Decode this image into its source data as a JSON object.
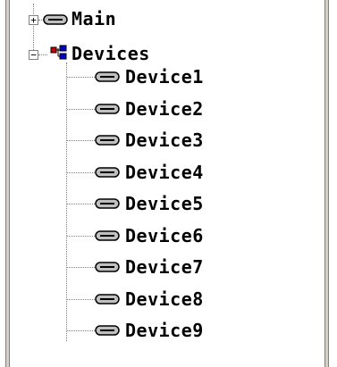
{
  "tree": {
    "main": {
      "label": "Main",
      "expander": "+",
      "icon": "device-icon"
    },
    "devices": {
      "label": "Devices",
      "expander": "−",
      "icon": "network-group-icon",
      "children": [
        {
          "label": "Device1",
          "icon": "device-icon"
        },
        {
          "label": "Device2",
          "icon": "device-icon"
        },
        {
          "label": "Device3",
          "icon": "device-icon"
        },
        {
          "label": "Device4",
          "icon": "device-icon"
        },
        {
          "label": "Device5",
          "icon": "device-icon"
        },
        {
          "label": "Device6",
          "icon": "device-icon"
        },
        {
          "label": "Device7",
          "icon": "device-icon"
        },
        {
          "label": "Device8",
          "icon": "device-icon"
        },
        {
          "label": "Device9",
          "icon": "device-icon"
        }
      ]
    }
  },
  "colors": {
    "panel_border": "#d4d0c8",
    "tree_line": "#808080",
    "text": "#000000",
    "network_icon_red": "#cc0000",
    "network_icon_blue": "#0000cc"
  }
}
